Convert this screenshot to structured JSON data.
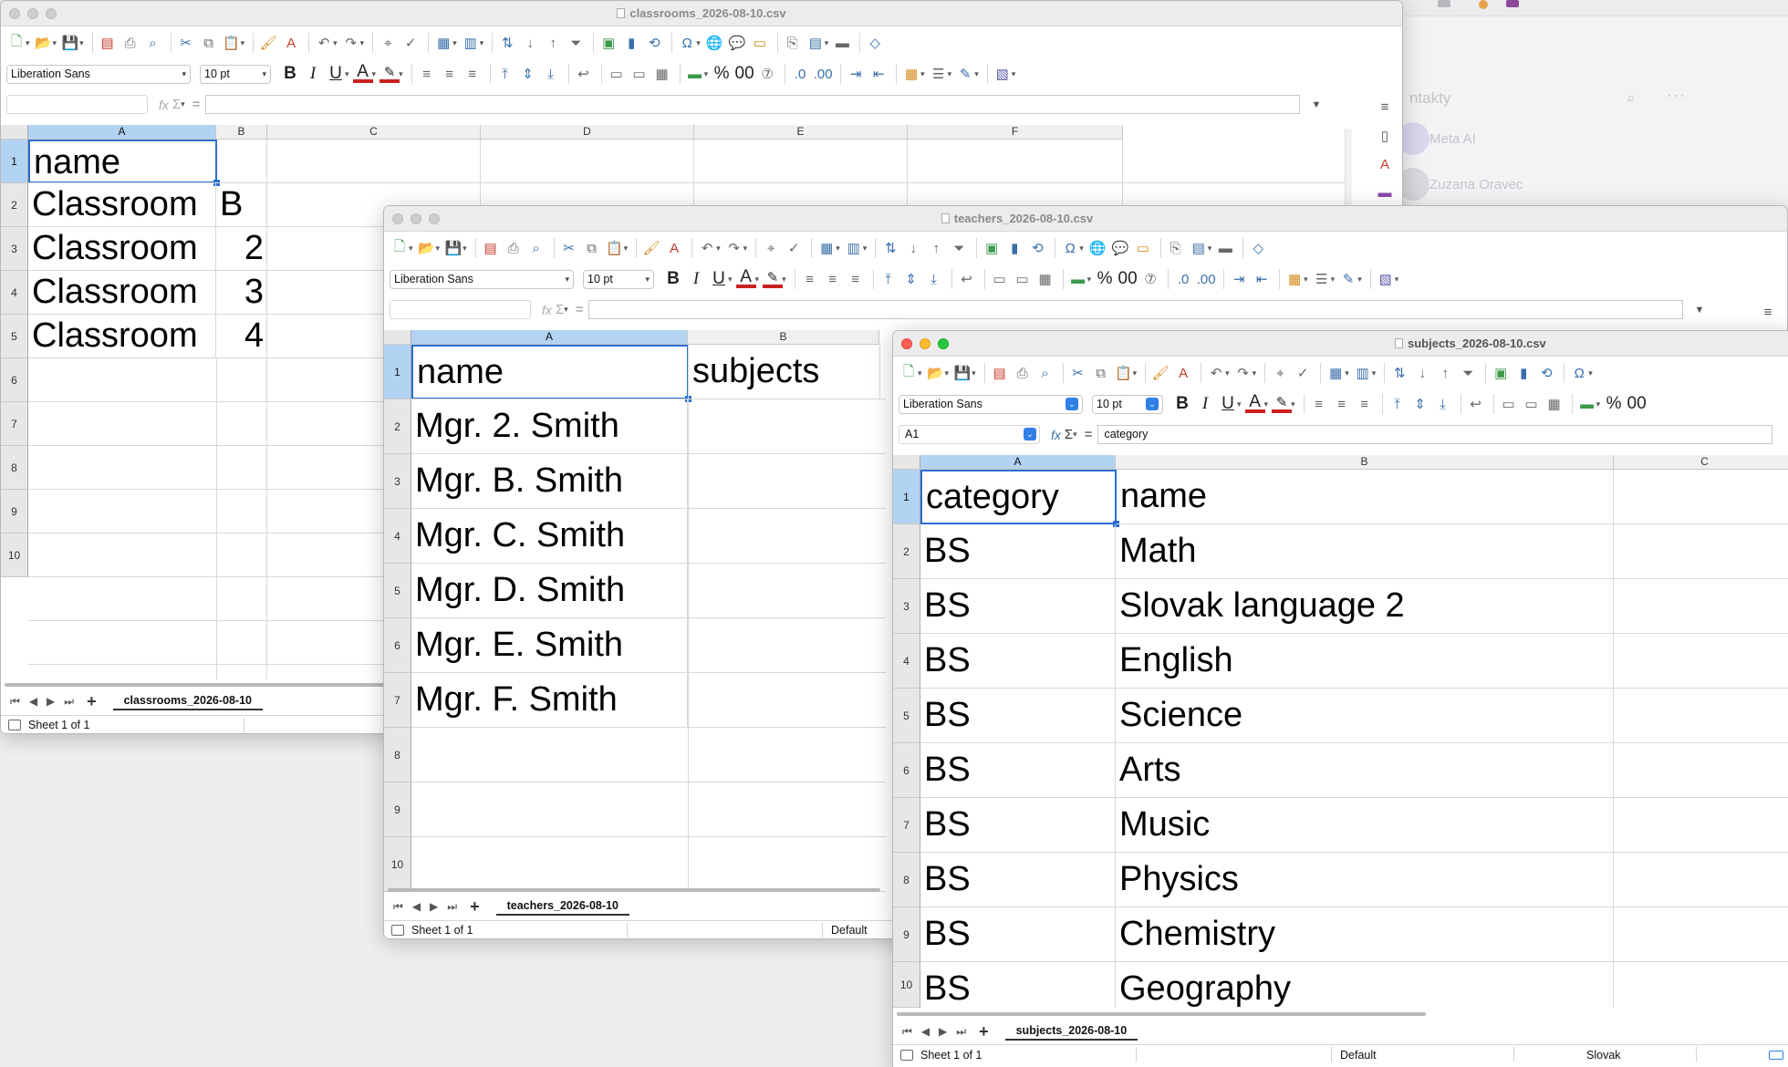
{
  "background_app": {
    "header": "ntakty",
    "contacts": [
      {
        "name": "Meta AI"
      },
      {
        "name": "Zuzana Oravec"
      }
    ]
  },
  "toolbar": {
    "font_name": "Liberation Sans",
    "font_size": "10 pt",
    "percent": "%",
    "decimal": "00",
    "fx": "fx",
    "sum": "Σ",
    "equals": "="
  },
  "windows": {
    "classrooms": {
      "title": "classrooms_2026-08-10.csv",
      "name_box": "",
      "formula": "",
      "columns": [
        "A",
        "B",
        "C",
        "D",
        "E",
        "F"
      ],
      "rows": [
        "1",
        "2",
        "3",
        "4",
        "5",
        "6",
        "7",
        "8",
        "9",
        "10"
      ],
      "cells": [
        [
          "name",
          ""
        ],
        [
          "Classroom",
          "B"
        ],
        [
          "Classroom",
          "2"
        ],
        [
          "Classroom",
          "3"
        ],
        [
          "Classroom",
          "4"
        ]
      ],
      "sheet_tab": "classrooms_2026-08-10",
      "status": "Sheet 1 of 1"
    },
    "teachers": {
      "title": "teachers_2026-08-10.csv",
      "name_box": "",
      "formula": "",
      "columns": [
        "A",
        "B"
      ],
      "rows": [
        "1",
        "2",
        "3",
        "4",
        "5",
        "6",
        "7",
        "8",
        "9",
        "10"
      ],
      "cells": [
        [
          "name",
          "subjects"
        ],
        [
          "Mgr. 2. Smith",
          ""
        ],
        [
          "Mgr. B. Smith",
          ""
        ],
        [
          "Mgr. C. Smith",
          ""
        ],
        [
          "Mgr. D. Smith",
          ""
        ],
        [
          "Mgr. E. Smith",
          ""
        ],
        [
          "Mgr. F. Smith",
          ""
        ]
      ],
      "sheet_tab": "teachers_2026-08-10",
      "status": "Sheet 1 of 1",
      "page_style": "Default"
    },
    "subjects": {
      "title": "subjects_2026-08-10.csv",
      "name_box": "A1",
      "formula": "category",
      "columns": [
        "A",
        "B",
        "C"
      ],
      "rows": [
        "1",
        "2",
        "3",
        "4",
        "5",
        "6",
        "7",
        "8",
        "9",
        "10"
      ],
      "cells": [
        [
          "category",
          "name"
        ],
        [
          "BS",
          "Math"
        ],
        [
          "BS",
          "Slovak language 2"
        ],
        [
          "BS",
          "English"
        ],
        [
          "BS",
          "Science"
        ],
        [
          "BS",
          "Arts"
        ],
        [
          "BS",
          "Music"
        ],
        [
          "BS",
          "Physics"
        ],
        [
          "BS",
          "Chemistry"
        ],
        [
          "BS",
          "Geography"
        ]
      ],
      "sheet_tab": "subjects_2026-08-10",
      "status": "Sheet 1 of 1",
      "page_style": "Default",
      "language": "Slovak"
    }
  }
}
